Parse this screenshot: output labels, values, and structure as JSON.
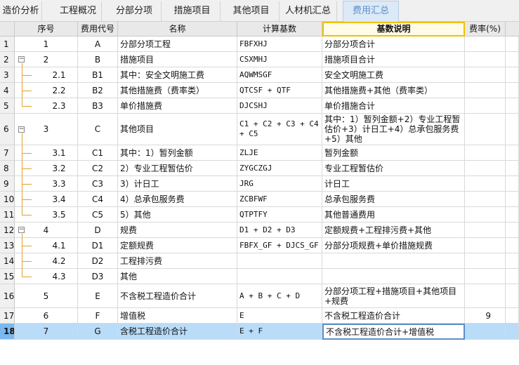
{
  "tabs": [
    {
      "label": "造价分析",
      "active": false
    },
    {
      "label": "工程概况",
      "active": false
    },
    {
      "label": "分部分项",
      "active": false
    },
    {
      "label": "措施项目",
      "active": false
    },
    {
      "label": "其他项目",
      "active": false
    },
    {
      "label": "人材机汇总",
      "active": false
    },
    {
      "label": "费用汇总",
      "active": true
    }
  ],
  "columns": {
    "seq": "序号",
    "code": "费用代号",
    "name": "名称",
    "base": "计算基数",
    "basis": "基数说明",
    "rate": "费率(%)"
  },
  "rows": [
    {
      "rn": "1",
      "seq": "1",
      "code": "A",
      "name": "分部分项工程",
      "base": "FBFXHJ",
      "basis": "分部分项合计",
      "rate": "",
      "level": 0,
      "toggle": ""
    },
    {
      "rn": "2",
      "seq": "2",
      "code": "B",
      "name": "措施项目",
      "base": "CSXMHJ",
      "basis": "措施项目合计",
      "rate": "",
      "level": 0,
      "toggle": "−"
    },
    {
      "rn": "3",
      "seq": "2.1",
      "code": "B1",
      "name": "其中：安全文明施工费",
      "base": "AQWMSGF",
      "basis": "安全文明施工费",
      "rate": "",
      "level": 1,
      "toggle": ""
    },
    {
      "rn": "4",
      "seq": "2.2",
      "code": "B2",
      "name": "其他措施费（费率类）",
      "base": "QTCSF + QTF",
      "basis": "其他措施费+其他（费率类）",
      "rate": "",
      "level": 1,
      "toggle": ""
    },
    {
      "rn": "5",
      "seq": "2.3",
      "code": "B3",
      "name": "单价措施费",
      "base": "DJCSHJ",
      "basis": "单价措施合计",
      "rate": "",
      "level": 1,
      "toggle": ""
    },
    {
      "rn": "6",
      "seq": "3",
      "code": "C",
      "name": "其他项目",
      "base": "C1 + C2 + C3 + C4 + C5",
      "basis": "其中：1）暂列金额+2）专业工程暂估价+3）计日工+4）总承包服务费+5）其他",
      "rate": "",
      "level": 0,
      "toggle": "−"
    },
    {
      "rn": "7",
      "seq": "3.1",
      "code": "C1",
      "name": "其中：1）暂列金额",
      "base": "ZLJE",
      "basis": "暂列金额",
      "rate": "",
      "level": 1,
      "toggle": ""
    },
    {
      "rn": "8",
      "seq": "3.2",
      "code": "C2",
      "name": "2）专业工程暂估价",
      "base": "ZYGCZGJ",
      "basis": "专业工程暂估价",
      "rate": "",
      "level": 1,
      "toggle": ""
    },
    {
      "rn": "9",
      "seq": "3.3",
      "code": "C3",
      "name": "3）计日工",
      "base": "JRG",
      "basis": "计日工",
      "rate": "",
      "level": 1,
      "toggle": ""
    },
    {
      "rn": "10",
      "seq": "3.4",
      "code": "C4",
      "name": "4）总承包服务费",
      "base": "ZCBFWF",
      "basis": "总承包服务费",
      "rate": "",
      "level": 1,
      "toggle": ""
    },
    {
      "rn": "11",
      "seq": "3.5",
      "code": "C5",
      "name": "5）其他",
      "base": "QTPTFY",
      "basis": "其他普通费用",
      "rate": "",
      "level": 1,
      "toggle": ""
    },
    {
      "rn": "12",
      "seq": "4",
      "code": "D",
      "name": "规费",
      "base": "D1 + D2 + D3",
      "basis": "定额规费+工程排污费+其他",
      "rate": "",
      "level": 0,
      "toggle": "−"
    },
    {
      "rn": "13",
      "seq": "4.1",
      "code": "D1",
      "name": "定额规费",
      "base": "FBFX_GF + DJCS_GF",
      "basis": "分部分项规费+单价措施规费",
      "rate": "",
      "level": 1,
      "toggle": ""
    },
    {
      "rn": "14",
      "seq": "4.2",
      "code": "D2",
      "name": "工程排污费",
      "base": "",
      "basis": "",
      "rate": "",
      "level": 1,
      "toggle": ""
    },
    {
      "rn": "15",
      "seq": "4.3",
      "code": "D3",
      "name": "其他",
      "base": "",
      "basis": "",
      "rate": "",
      "level": 1,
      "toggle": ""
    },
    {
      "rn": "16",
      "seq": "5",
      "code": "E",
      "name": "不含税工程造价合计",
      "base": "A + B + C + D",
      "basis": "分部分项工程+措施项目+其他项目+规费",
      "rate": "",
      "level": 0,
      "toggle": ""
    },
    {
      "rn": "17",
      "seq": "6",
      "code": "F",
      "name": "增值税",
      "base": "E",
      "basis": "不含税工程造价合计",
      "rate": "9",
      "level": 0,
      "toggle": ""
    },
    {
      "rn": "18",
      "seq": "7",
      "code": "G",
      "name": "含税工程造价合计",
      "base": "E + F",
      "basis": "不含税工程造价合计+增值税",
      "rate": "",
      "level": 0,
      "toggle": "",
      "selected": true
    }
  ]
}
